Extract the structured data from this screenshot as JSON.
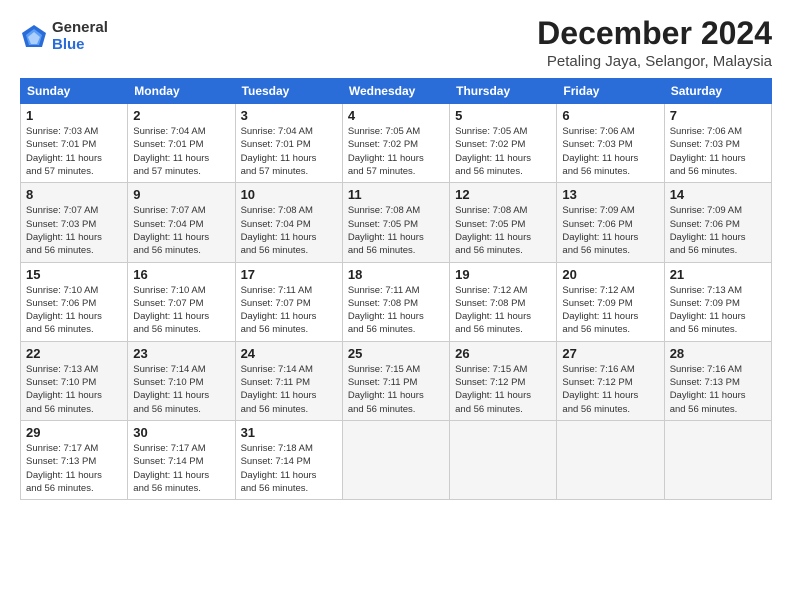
{
  "logo": {
    "general": "General",
    "blue": "Blue"
  },
  "title": "December 2024",
  "subtitle": "Petaling Jaya, Selangor, Malaysia",
  "days_header": [
    "Sunday",
    "Monday",
    "Tuesday",
    "Wednesday",
    "Thursday",
    "Friday",
    "Saturday"
  ],
  "weeks": [
    [
      {
        "day": "1",
        "info": "Sunrise: 7:03 AM\nSunset: 7:01 PM\nDaylight: 11 hours\nand 57 minutes."
      },
      {
        "day": "2",
        "info": "Sunrise: 7:04 AM\nSunset: 7:01 PM\nDaylight: 11 hours\nand 57 minutes."
      },
      {
        "day": "3",
        "info": "Sunrise: 7:04 AM\nSunset: 7:01 PM\nDaylight: 11 hours\nand 57 minutes."
      },
      {
        "day": "4",
        "info": "Sunrise: 7:05 AM\nSunset: 7:02 PM\nDaylight: 11 hours\nand 57 minutes."
      },
      {
        "day": "5",
        "info": "Sunrise: 7:05 AM\nSunset: 7:02 PM\nDaylight: 11 hours\nand 56 minutes."
      },
      {
        "day": "6",
        "info": "Sunrise: 7:06 AM\nSunset: 7:03 PM\nDaylight: 11 hours\nand 56 minutes."
      },
      {
        "day": "7",
        "info": "Sunrise: 7:06 AM\nSunset: 7:03 PM\nDaylight: 11 hours\nand 56 minutes."
      }
    ],
    [
      {
        "day": "8",
        "info": "Sunrise: 7:07 AM\nSunset: 7:03 PM\nDaylight: 11 hours\nand 56 minutes."
      },
      {
        "day": "9",
        "info": "Sunrise: 7:07 AM\nSunset: 7:04 PM\nDaylight: 11 hours\nand 56 minutes."
      },
      {
        "day": "10",
        "info": "Sunrise: 7:08 AM\nSunset: 7:04 PM\nDaylight: 11 hours\nand 56 minutes."
      },
      {
        "day": "11",
        "info": "Sunrise: 7:08 AM\nSunset: 7:05 PM\nDaylight: 11 hours\nand 56 minutes."
      },
      {
        "day": "12",
        "info": "Sunrise: 7:08 AM\nSunset: 7:05 PM\nDaylight: 11 hours\nand 56 minutes."
      },
      {
        "day": "13",
        "info": "Sunrise: 7:09 AM\nSunset: 7:06 PM\nDaylight: 11 hours\nand 56 minutes."
      },
      {
        "day": "14",
        "info": "Sunrise: 7:09 AM\nSunset: 7:06 PM\nDaylight: 11 hours\nand 56 minutes."
      }
    ],
    [
      {
        "day": "15",
        "info": "Sunrise: 7:10 AM\nSunset: 7:06 PM\nDaylight: 11 hours\nand 56 minutes."
      },
      {
        "day": "16",
        "info": "Sunrise: 7:10 AM\nSunset: 7:07 PM\nDaylight: 11 hours\nand 56 minutes."
      },
      {
        "day": "17",
        "info": "Sunrise: 7:11 AM\nSunset: 7:07 PM\nDaylight: 11 hours\nand 56 minutes."
      },
      {
        "day": "18",
        "info": "Sunrise: 7:11 AM\nSunset: 7:08 PM\nDaylight: 11 hours\nand 56 minutes."
      },
      {
        "day": "19",
        "info": "Sunrise: 7:12 AM\nSunset: 7:08 PM\nDaylight: 11 hours\nand 56 minutes."
      },
      {
        "day": "20",
        "info": "Sunrise: 7:12 AM\nSunset: 7:09 PM\nDaylight: 11 hours\nand 56 minutes."
      },
      {
        "day": "21",
        "info": "Sunrise: 7:13 AM\nSunset: 7:09 PM\nDaylight: 11 hours\nand 56 minutes."
      }
    ],
    [
      {
        "day": "22",
        "info": "Sunrise: 7:13 AM\nSunset: 7:10 PM\nDaylight: 11 hours\nand 56 minutes."
      },
      {
        "day": "23",
        "info": "Sunrise: 7:14 AM\nSunset: 7:10 PM\nDaylight: 11 hours\nand 56 minutes."
      },
      {
        "day": "24",
        "info": "Sunrise: 7:14 AM\nSunset: 7:11 PM\nDaylight: 11 hours\nand 56 minutes."
      },
      {
        "day": "25",
        "info": "Sunrise: 7:15 AM\nSunset: 7:11 PM\nDaylight: 11 hours\nand 56 minutes."
      },
      {
        "day": "26",
        "info": "Sunrise: 7:15 AM\nSunset: 7:12 PM\nDaylight: 11 hours\nand 56 minutes."
      },
      {
        "day": "27",
        "info": "Sunrise: 7:16 AM\nSunset: 7:12 PM\nDaylight: 11 hours\nand 56 minutes."
      },
      {
        "day": "28",
        "info": "Sunrise: 7:16 AM\nSunset: 7:13 PM\nDaylight: 11 hours\nand 56 minutes."
      }
    ],
    [
      {
        "day": "29",
        "info": "Sunrise: 7:17 AM\nSunset: 7:13 PM\nDaylight: 11 hours\nand 56 minutes."
      },
      {
        "day": "30",
        "info": "Sunrise: 7:17 AM\nSunset: 7:14 PM\nDaylight: 11 hours\nand 56 minutes."
      },
      {
        "day": "31",
        "info": "Sunrise: 7:18 AM\nSunset: 7:14 PM\nDaylight: 11 hours\nand 56 minutes."
      },
      {
        "day": "",
        "info": ""
      },
      {
        "day": "",
        "info": ""
      },
      {
        "day": "",
        "info": ""
      },
      {
        "day": "",
        "info": ""
      }
    ]
  ]
}
